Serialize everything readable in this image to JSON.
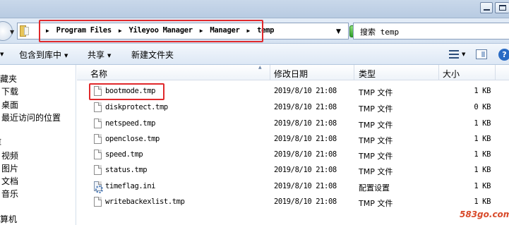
{
  "address": {
    "crumbs": [
      "Program Files",
      "Yileyoo Manager",
      "Manager",
      "temp"
    ]
  },
  "search": {
    "text": "搜索 temp"
  },
  "toolbar": {
    "include_library": "包含到库中",
    "share": "共享",
    "new_folder": "新建文件夹"
  },
  "nav": {
    "favorites": "收藏夹",
    "downloads": "下载",
    "desktop": "桌面",
    "recent": "最近访问的位置",
    "libraries": "库",
    "videos": "视频",
    "pictures": "图片",
    "documents": "文档",
    "music": "音乐",
    "computer": "计算机"
  },
  "columns": {
    "name": "名称",
    "date": "修改日期",
    "type": "类型",
    "size": "大小"
  },
  "files": [
    {
      "name": "bootmode.tmp",
      "date": "2019/8/10 21:08",
      "type": "TMP 文件",
      "size": "1 KB",
      "icon": "file-icon"
    },
    {
      "name": "diskprotect.tmp",
      "date": "2019/8/10 21:08",
      "type": "TMP 文件",
      "size": "0 KB",
      "icon": "file-icon"
    },
    {
      "name": "netspeed.tmp",
      "date": "2019/8/10 21:08",
      "type": "TMP 文件",
      "size": "1 KB",
      "icon": "file-icon"
    },
    {
      "name": "openclose.tmp",
      "date": "2019/8/10 21:08",
      "type": "TMP 文件",
      "size": "1 KB",
      "icon": "file-icon"
    },
    {
      "name": "speed.tmp",
      "date": "2019/8/10 21:08",
      "type": "TMP 文件",
      "size": "1 KB",
      "icon": "file-icon"
    },
    {
      "name": "status.tmp",
      "date": "2019/8/10 21:08",
      "type": "TMP 文件",
      "size": "1 KB",
      "icon": "file-icon"
    },
    {
      "name": "timeflag.ini",
      "date": "2019/8/10 21:08",
      "type": "配置设置",
      "size": "1 KB",
      "icon": "settings-file-icon"
    },
    {
      "name": "writebackexlist.tmp",
      "date": "2019/8/10 21:08",
      "type": "TMP 文件",
      "size": "1 KB",
      "icon": "file-icon"
    }
  ],
  "watermark": "583go.com",
  "colors": {
    "highlight_red": "#e0292c",
    "refresh_green": "#2f9f2a",
    "watermark": "#d84a2a"
  }
}
